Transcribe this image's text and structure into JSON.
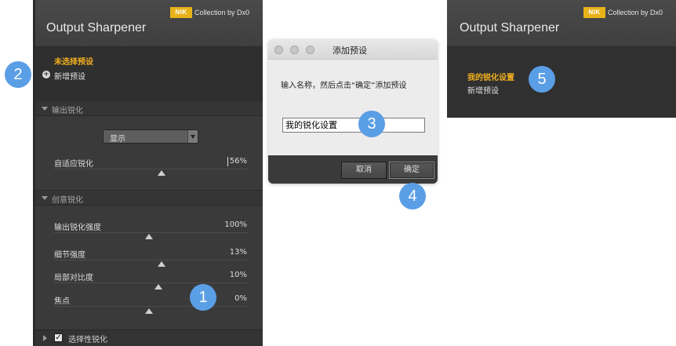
{
  "left_panel": {
    "collection_text": "Collection by Dx0",
    "nik_logo": "NIK",
    "title": "Output Sharpener",
    "preset_selected": "未选择预设",
    "preset_new": "新增预设",
    "section_output": "输出锐化",
    "dropdown_value": "显示",
    "adaptive_label": "自适应锐化",
    "adaptive_value": "56%",
    "section_creative": "创意锐化",
    "sliders": [
      {
        "label": "输出锐化强度",
        "value": "100%"
      },
      {
        "label": "细节强度",
        "value": "13%"
      },
      {
        "label": "局部对比度",
        "value": "10%"
      },
      {
        "label": "焦点",
        "value": "0%"
      }
    ],
    "selective_label": "选择性锐化",
    "selective_check": "✓"
  },
  "dialog": {
    "title": "添加预设",
    "message": "输入名称，然后点击“确定”添加预设",
    "input_value": "我的锐化设置",
    "cancel_label": "取消",
    "ok_label": "确定"
  },
  "right_panel": {
    "collection_text": "Collection by Dx0",
    "nik_logo": "NIK",
    "title": "Output Sharpener",
    "preset_selected": "我的锐化设置",
    "preset_new": "新增预设"
  },
  "badges": [
    "1",
    "2",
    "3",
    "4",
    "5"
  ],
  "colors": {
    "accent": "#f2b01e",
    "badge": "#5a9ee6",
    "panel_bg": "#3a3a3a"
  }
}
